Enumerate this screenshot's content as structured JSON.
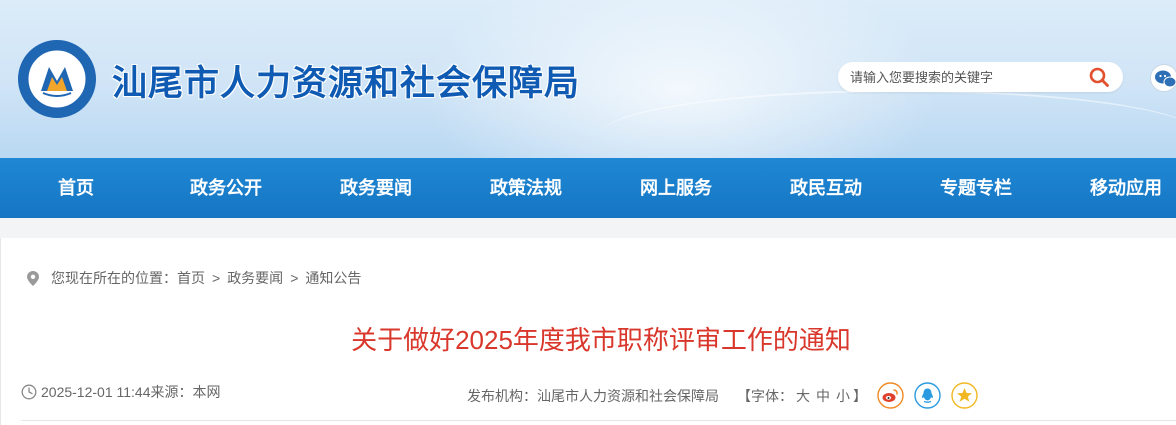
{
  "header": {
    "site_title": "汕尾市人力资源和社会保障局",
    "search": {
      "placeholder": "请输入您要搜索的关键字",
      "value": ""
    },
    "icons": {
      "logo": "emblem-logo-icon",
      "search": "search-icon",
      "wechat": "wechat-icon"
    }
  },
  "nav": {
    "items": [
      {
        "label": "首页"
      },
      {
        "label": "政务公开"
      },
      {
        "label": "政务要闻"
      },
      {
        "label": "政策法规"
      },
      {
        "label": "网上服务"
      },
      {
        "label": "政民互动"
      },
      {
        "label": "专题专栏"
      },
      {
        "label": "移动应用"
      }
    ]
  },
  "breadcrumb": {
    "prefix": "您现在所在的位置：",
    "items": [
      "首页",
      "政务要闻",
      "通知公告"
    ],
    "separator": ">"
  },
  "article": {
    "title": "关于做好2025年度我市职称评审工作的通知",
    "date": "2025-12-01 11:44",
    "source_label": "来源：",
    "source": "本网",
    "publisher_label": "发布机构：",
    "publisher": "汕尾市人力资源和社会保障局",
    "font_size": {
      "open": "【字体：",
      "large": "大",
      "medium": "中",
      "small": "小",
      "close": "】"
    },
    "share_icons": [
      "weibo-icon",
      "qq-icon",
      "qzone-icon"
    ]
  },
  "colors": {
    "nav_bg": "#1a7fcc",
    "title_red": "#d9372b",
    "brand_blue": "#0f5bb3",
    "share_orange": "#f08a24",
    "share_blue": "#2a9be0",
    "share_gold": "#f2b824"
  }
}
